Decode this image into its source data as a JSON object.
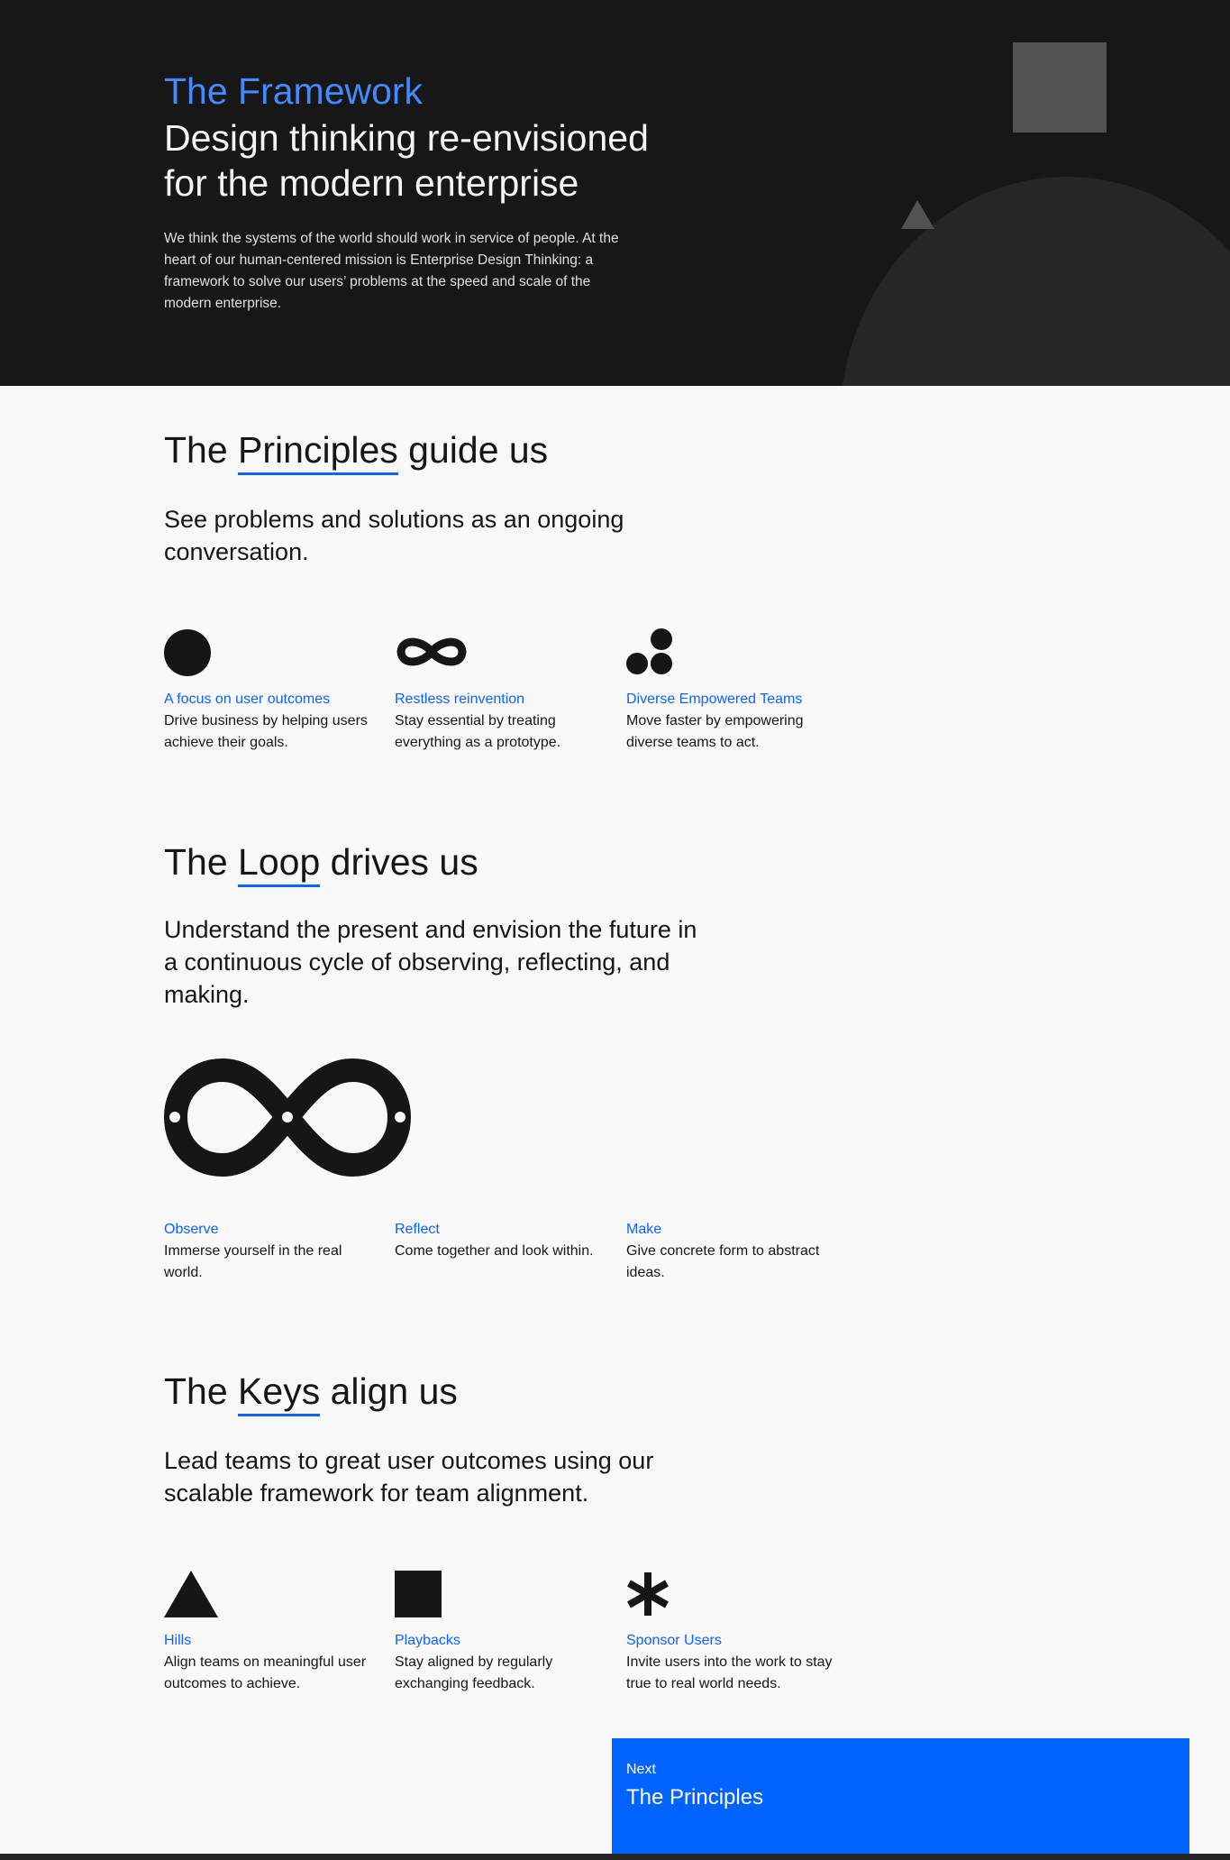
{
  "hero": {
    "kicker": "The Framework",
    "headline_line1": "Design thinking re-envisioned",
    "headline_line2": "for the modern enterprise",
    "intro": "We think the systems of the world should work in service of people. At the heart of our human-centered mission is Enterprise Design Thinking: a framework to solve our users’ problems at the speed and scale of the modern enterprise."
  },
  "principles": {
    "title_pre": "The ",
    "title_key": "Principles",
    "title_post": " guide us",
    "subtitle": "See problems and solutions as an ongoing conversation.",
    "items": [
      {
        "icon": "circle-icon",
        "label": "A focus on user outcomes",
        "desc": "Drive business by helping users achieve their goals."
      },
      {
        "icon": "infinity-icon",
        "label": "Restless reinvention",
        "desc": "Stay essential by treating everything as a prototype."
      },
      {
        "icon": "three-dots-icon",
        "label": "Diverse Empowered Teams",
        "desc": "Move faster by empowering diverse teams to act."
      }
    ]
  },
  "loop": {
    "title_pre": "The ",
    "title_key": "Loop",
    "title_post": " drives us",
    "subtitle": "Understand the present and envision the future in a continuous cycle of observing, reflecting, and making.",
    "items": [
      {
        "label": "Observe",
        "desc": "Immerse yourself in the real world."
      },
      {
        "label": "Reflect",
        "desc": "Come together and look within."
      },
      {
        "label": "Make",
        "desc": "Give concrete form to abstract ideas."
      }
    ]
  },
  "keys": {
    "title_pre": "The ",
    "title_key": "Keys",
    "title_post": " align us",
    "subtitle": "Lead teams to great user outcomes using our scalable framework for team alignment.",
    "items": [
      {
        "icon": "triangle-icon",
        "label": "Hills",
        "desc": "Align teams on meaningful user outcomes to achieve."
      },
      {
        "icon": "square-icon",
        "label": "Playbacks",
        "desc": "Stay aligned by regularly exchanging feedback."
      },
      {
        "icon": "asterisk-icon",
        "label": "Sponsor Users",
        "desc": "Invite users into the work to stay true to real world needs."
      }
    ]
  },
  "next": {
    "label": "Next",
    "title": "The Principles"
  },
  "colors": {
    "accent": "#0f62fe",
    "hero_bg": "#171717",
    "next_bg": "#0062ff",
    "kicker": "#4589ff"
  }
}
